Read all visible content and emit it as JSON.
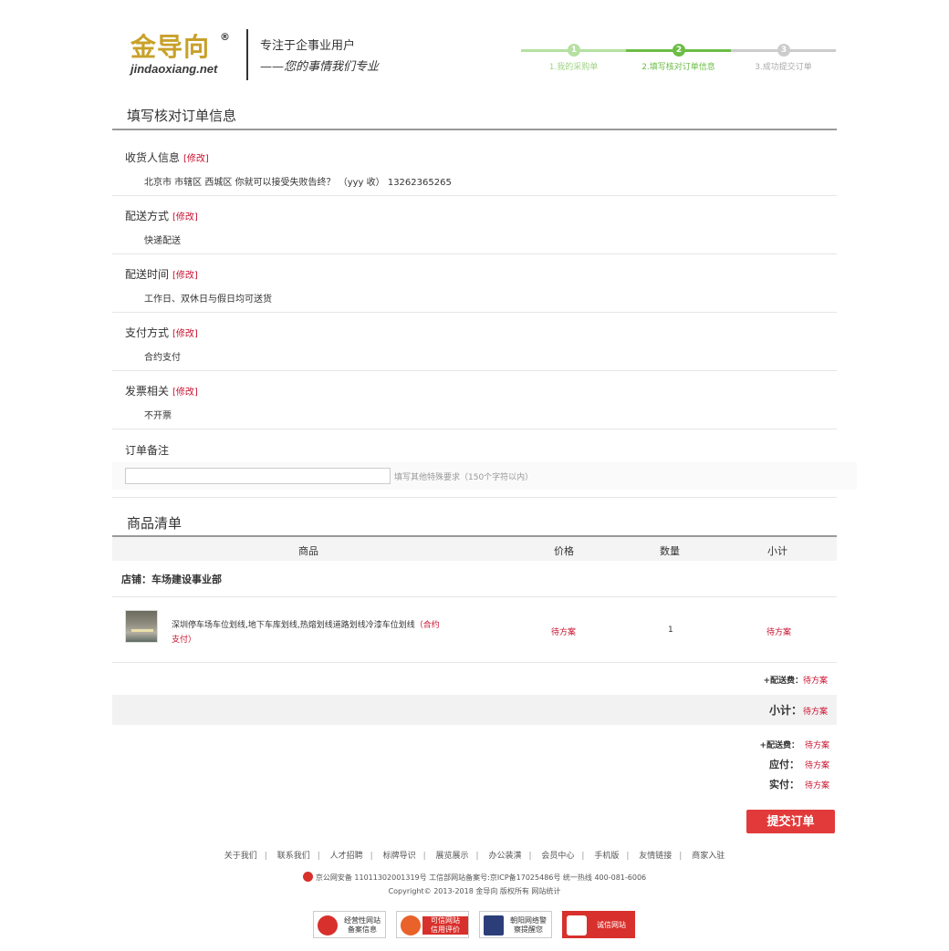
{
  "header": {
    "logo_cn": "金导向",
    "logo_reg": "®",
    "logo_en": "jindaoxiang.net",
    "slogan_line1": "专注于企事业用户",
    "slogan_line2": "——您的事情我们专业",
    "steps": [
      {
        "num": "1",
        "label": "1.我的采购单"
      },
      {
        "num": "2",
        "label": "2.填写核对订单信息"
      },
      {
        "num": "3",
        "label": "3.成功提交订单"
      }
    ]
  },
  "order_info": {
    "title": "填写核对订单信息",
    "edit_label": "[修改]",
    "receiver": {
      "label": "收货人信息",
      "value": "北京市  市辖区  西城区    你就可以接受失败告终？   （yyy  收）   13262365265"
    },
    "delivery_method": {
      "label": "配送方式",
      "value": "快递配送"
    },
    "delivery_time": {
      "label": "配送时间",
      "value": "工作日、双休日与假日均可送货"
    },
    "payment": {
      "label": "支付方式",
      "value": "合约支付"
    },
    "invoice": {
      "label": "发票相关",
      "value": "不开票"
    },
    "remark": {
      "label": "订单备注",
      "input_value": "",
      "hint": "填写其他特殊要求（150个字符以内）"
    }
  },
  "goods": {
    "title": "商品清单",
    "columns": [
      "商品",
      "价格",
      "数量",
      "小计"
    ],
    "shop_name": "店铺：车场建设事业部",
    "items": [
      {
        "name": "深圳停车场车位划线,地下车库划线,热熔划线道路划线冷漆车位划线",
        "tag": "（合约支付）",
        "price": "待方案",
        "qty": "1",
        "subtotal": "待方案"
      }
    ],
    "shipping_label": "+配送费：",
    "shipping_value": "待方案",
    "subtotal_label": "小计：",
    "subtotal_value": "待方案"
  },
  "summary": {
    "shipping_label": "+配送费：",
    "shipping_value": "待方案",
    "payable_label": "应付：",
    "payable_value": "待方案",
    "paid_label": "实付：",
    "paid_value": "待方案",
    "submit_label": "提交订单"
  },
  "footer": {
    "links": [
      "关于我们",
      "联系我们",
      "人才招聘",
      "标牌导识",
      "展览展示",
      "办公装潢",
      "会员中心",
      "手机版",
      "友情链接",
      "商家入驻"
    ],
    "beian": "京公网安备 11011302001319号      工信部网站备案号:京ICP备17025486号    统一热线 400-081-6006",
    "copyright": "Copyright© 2013-2018 金导向 版权所有    网站统计",
    "badges": [
      {
        "line1": "经营性网站",
        "line2": "备案信息"
      },
      {
        "line1": "可信网站",
        "line2": "信用评价"
      },
      {
        "line1": "朝阳网络警",
        "line2": "察提醒您"
      },
      {
        "line1": "诚信网站",
        "line2": ""
      }
    ]
  }
}
